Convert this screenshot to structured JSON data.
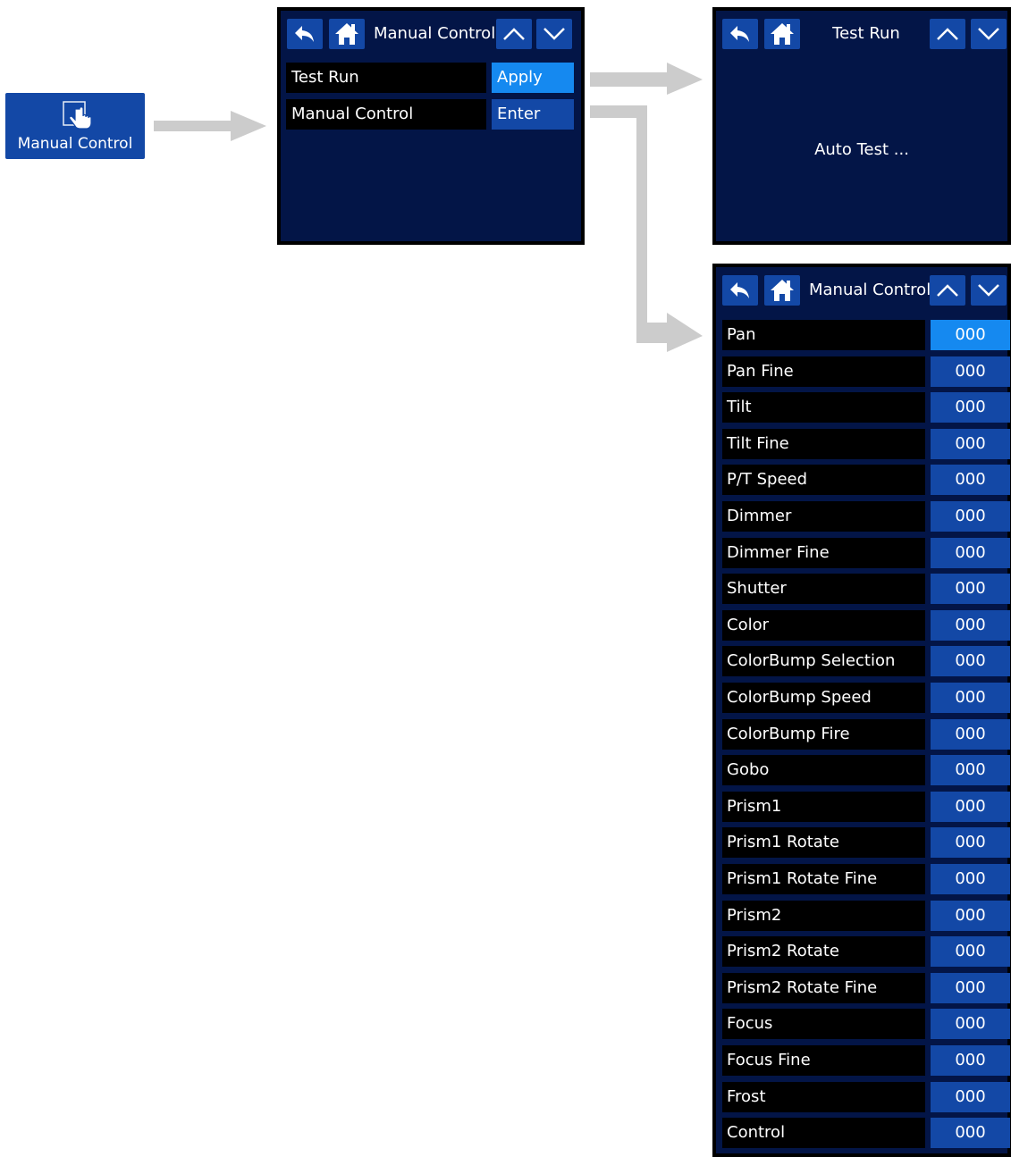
{
  "launcher": {
    "label": "Manual Control",
    "icon": "touch-hand-icon"
  },
  "menu_screen": {
    "title": "Manual Control",
    "rows": [
      {
        "label": "Test Run",
        "action": "Apply",
        "selected": true
      },
      {
        "label": "Manual Control",
        "action": "Enter",
        "selected": false
      }
    ]
  },
  "test_run_screen": {
    "title": "Test Run",
    "message": "Auto Test ..."
  },
  "manual_screen": {
    "title": "Manual Control",
    "rows": [
      {
        "label": "Pan",
        "value": "000"
      },
      {
        "label": "Pan Fine",
        "value": "000"
      },
      {
        "label": "Tilt",
        "value": "000"
      },
      {
        "label": "Tilt Fine",
        "value": "000"
      },
      {
        "label": "P/T Speed",
        "value": "000"
      },
      {
        "label": "Dimmer",
        "value": "000"
      },
      {
        "label": "Dimmer Fine",
        "value": "000"
      },
      {
        "label": "Shutter",
        "value": "000"
      },
      {
        "label": "Color",
        "value": "000"
      },
      {
        "label": "ColorBump Selection",
        "value": "000"
      },
      {
        "label": "ColorBump Speed",
        "value": "000"
      },
      {
        "label": "ColorBump Fire",
        "value": "000"
      },
      {
        "label": "Gobo",
        "value": "000"
      },
      {
        "label": "Prism1",
        "value": "000"
      },
      {
        "label": "Prism1 Rotate",
        "value": "000"
      },
      {
        "label": "Prism1 Rotate Fine",
        "value": "000"
      },
      {
        "label": "Prism2",
        "value": "000"
      },
      {
        "label": "Prism2 Rotate",
        "value": "000"
      },
      {
        "label": "Prism2 Rotate Fine",
        "value": "000"
      },
      {
        "label": "Focus",
        "value": "000"
      },
      {
        "label": "Focus Fine",
        "value": "000"
      },
      {
        "label": "Frost",
        "value": "000"
      },
      {
        "label": "Control",
        "value": "000"
      }
    ]
  },
  "icons": {
    "back": "back-arrow-icon",
    "home": "home-icon",
    "up": "chevron-up-icon",
    "down": "chevron-down-icon"
  },
  "colors": {
    "screen_bg": "#031547",
    "button_blue": "#1348a6",
    "selected_blue": "#1589f0",
    "label_bg": "#000000",
    "arrow_gray": "#cccccc"
  }
}
